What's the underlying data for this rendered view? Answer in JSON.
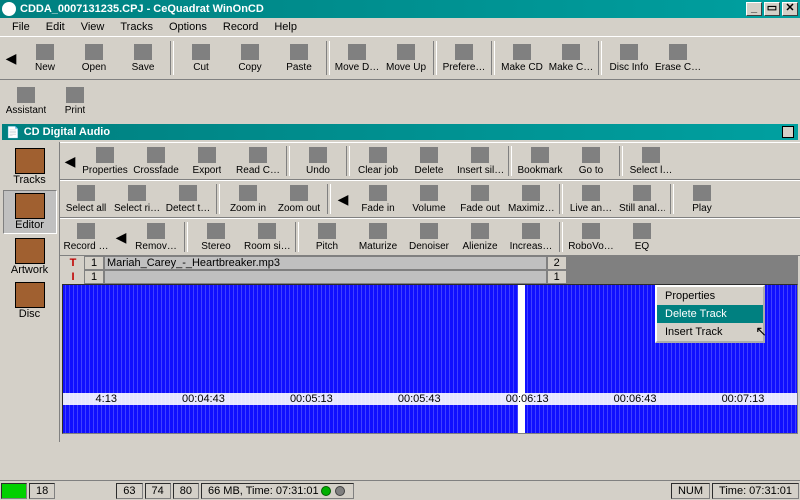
{
  "window": {
    "title": "CDDA_0007131235.CPJ - CeQuadrat WinOnCD",
    "min": "_",
    "max": "▭",
    "close": "✕"
  },
  "menu": [
    "File",
    "Edit",
    "View",
    "Tracks",
    "Options",
    "Record",
    "Help"
  ],
  "toolbar1": [
    {
      "n": "arrow-left",
      "l": ""
    },
    {
      "n": "new",
      "l": "New"
    },
    {
      "n": "open",
      "l": "Open"
    },
    {
      "n": "save",
      "l": "Save"
    },
    {
      "n": "sep"
    },
    {
      "n": "cut",
      "l": "Cut"
    },
    {
      "n": "copy",
      "l": "Copy"
    },
    {
      "n": "paste",
      "l": "Paste"
    },
    {
      "n": "sep"
    },
    {
      "n": "movedown",
      "l": "Move D…"
    },
    {
      "n": "moveup",
      "l": "Move Up"
    },
    {
      "n": "sep"
    },
    {
      "n": "prefer",
      "l": "Prefere…"
    },
    {
      "n": "sep"
    },
    {
      "n": "makecd",
      "l": "Make CD"
    },
    {
      "n": "makec",
      "l": "Make C…"
    },
    {
      "n": "sep"
    },
    {
      "n": "discinfo",
      "l": "Disc Info"
    },
    {
      "n": "erase",
      "l": "Erase C…"
    }
  ],
  "toolbar2": [
    {
      "n": "assistant",
      "l": "Assistant"
    },
    {
      "n": "print",
      "l": "Print"
    }
  ],
  "panel_title": "CD Digital Audio",
  "sidenav": [
    {
      "n": "tracks",
      "l": "Tracks"
    },
    {
      "n": "editor",
      "l": "Editor",
      "sel": true
    },
    {
      "n": "artwork",
      "l": "Artwork"
    },
    {
      "n": "disc",
      "l": "Disc"
    }
  ],
  "etool1": [
    {
      "n": "arrow-left",
      "l": ""
    },
    {
      "n": "properties",
      "l": "Properties"
    },
    {
      "n": "crossfade",
      "l": "Crossfade"
    },
    {
      "n": "export",
      "l": "Export"
    },
    {
      "n": "readcd",
      "l": "Read C…"
    },
    {
      "n": "sep"
    },
    {
      "n": "undo",
      "l": "Undo"
    },
    {
      "n": "sep"
    },
    {
      "n": "clearjob",
      "l": "Clear job"
    },
    {
      "n": "delete",
      "l": "Delete"
    },
    {
      "n": "insertsil",
      "l": "Insert sil…"
    },
    {
      "n": "sep"
    },
    {
      "n": "bookmark",
      "l": "Bookmark"
    },
    {
      "n": "goto",
      "l": "Go to"
    },
    {
      "n": "sep"
    },
    {
      "n": "select",
      "l": "Select l…"
    }
  ],
  "etool2": [
    {
      "n": "selectall",
      "l": "Select all"
    },
    {
      "n": "selectri",
      "l": "Select ri…"
    },
    {
      "n": "detect",
      "l": "Detect t…"
    },
    {
      "n": "sep"
    },
    {
      "n": "zoomin",
      "l": "Zoom in"
    },
    {
      "n": "zoomout",
      "l": "Zoom out"
    },
    {
      "n": "sep"
    },
    {
      "n": "arrow-left2",
      "l": ""
    },
    {
      "n": "fadein",
      "l": "Fade in"
    },
    {
      "n": "volume",
      "l": "Volume"
    },
    {
      "n": "fadeout",
      "l": "Fade out"
    },
    {
      "n": "maximiz",
      "l": "Maximiz…"
    },
    {
      "n": "sep"
    },
    {
      "n": "livean",
      "l": "Live an…"
    },
    {
      "n": "stillan",
      "l": "Still anal…"
    },
    {
      "n": "sep"
    },
    {
      "n": "play",
      "l": "Play"
    }
  ],
  "etool3": [
    {
      "n": "record",
      "l": "Record …"
    },
    {
      "n": "arrow-left3",
      "l": ""
    },
    {
      "n": "remov",
      "l": "Remov…"
    },
    {
      "n": "sep"
    },
    {
      "n": "stereo",
      "l": "Stereo"
    },
    {
      "n": "roomsi",
      "l": "Room si…"
    },
    {
      "n": "sep"
    },
    {
      "n": "pitch",
      "l": "Pitch"
    },
    {
      "n": "maturize",
      "l": "Maturize"
    },
    {
      "n": "denoiser",
      "l": "Denoiser"
    },
    {
      "n": "alienize",
      "l": "Alienize"
    },
    {
      "n": "increas",
      "l": "Increas…"
    },
    {
      "n": "sep"
    },
    {
      "n": "robovo",
      "l": "RoboVo…"
    },
    {
      "n": "eq",
      "l": "EQ"
    }
  ],
  "tracks": {
    "t1": {
      "num": "1",
      "name": "Mariah_Carey_-_Heartbreaker.mp3"
    },
    "t2": {
      "num": "2",
      "name": ""
    },
    "sub1": "1",
    "sub2": "1"
  },
  "timecodes": [
    "4:13",
    "00:04:43",
    "00:05:13",
    "00:05:43",
    "00:06:13",
    "00:06:43",
    "00:07:13"
  ],
  "ctx": {
    "a": "Properties",
    "b": "Delete Track",
    "c": "Insert Track"
  },
  "markers": {
    "T": "T",
    "I": "I"
  },
  "status": {
    "n1": "18",
    "n2": "63",
    "n3": "74",
    "n4": "80",
    "info": "66 MB, Time: 07:31:01",
    "num": "NUM",
    "time": "Time: 07:31:01"
  }
}
